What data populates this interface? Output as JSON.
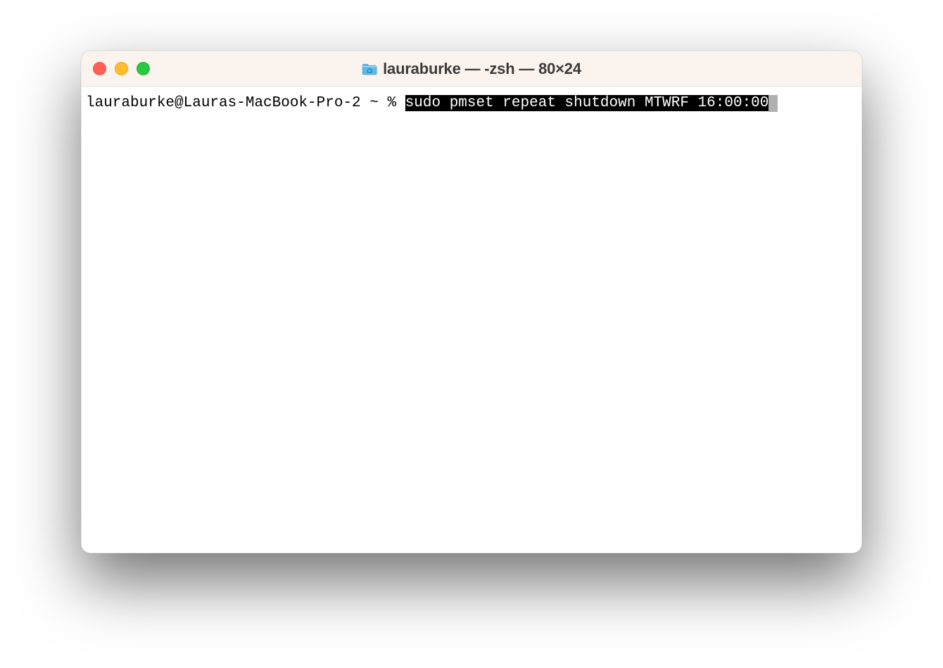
{
  "window": {
    "title": "lauraburke — -zsh — 80×24",
    "traffic_lights": {
      "close": "close",
      "minimize": "minimize",
      "zoom": "zoom"
    },
    "folder_icon": "home-folder-icon"
  },
  "terminal": {
    "prompt": "lauraburke@Lauras-MacBook-Pro-2 ~ % ",
    "command_selected": "sudo pmset repeat shutdown MTWRF 16:00:00"
  }
}
